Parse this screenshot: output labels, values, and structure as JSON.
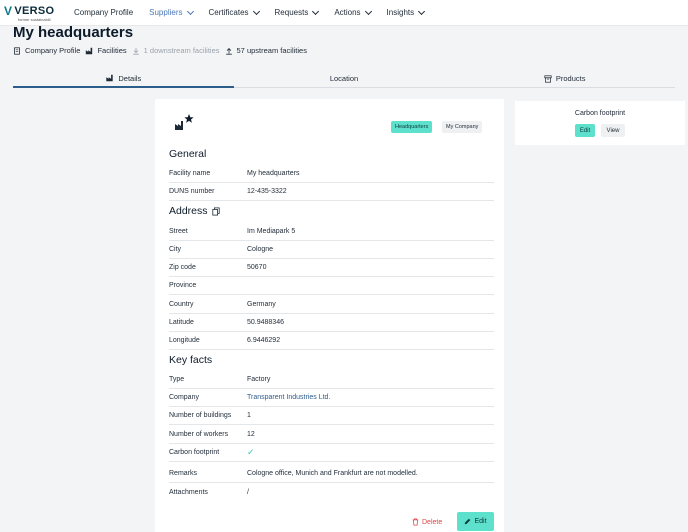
{
  "logo": {
    "name": "VERSO",
    "sub": "former sustainabill"
  },
  "nav": [
    {
      "label": "Company Profile",
      "dropdown": false,
      "active": false
    },
    {
      "label": "Suppliers",
      "dropdown": true,
      "active": true
    },
    {
      "label": "Certificates",
      "dropdown": true,
      "active": false
    },
    {
      "label": "Requests",
      "dropdown": true,
      "active": false
    },
    {
      "label": "Actions",
      "dropdown": true,
      "active": false
    },
    {
      "label": "Insights",
      "dropdown": true,
      "active": false
    }
  ],
  "page": {
    "title": "My headquarters"
  },
  "breadcrumb": {
    "profile": "Company Profile",
    "facilities": "Facilities",
    "downstream": "1 downstream facilities",
    "upstream": "57 upstream facilities"
  },
  "tabs": {
    "details": "Details",
    "location": "Location",
    "products": "Products"
  },
  "badges": {
    "hq": "Headquarters",
    "my_company": "My Company"
  },
  "general": {
    "heading": "General",
    "rows": [
      {
        "label": "Facility name",
        "value": "My headquarters"
      },
      {
        "label": "DUNS number",
        "value": "12-435-3322"
      }
    ]
  },
  "address": {
    "heading": "Address",
    "rows": [
      {
        "label": "Street",
        "value": "Im Mediapark 5"
      },
      {
        "label": "City",
        "value": "Cologne"
      },
      {
        "label": "Zip code",
        "value": "50670"
      },
      {
        "label": "Province",
        "value": ""
      },
      {
        "label": "Country",
        "value": "Germany"
      },
      {
        "label": "Latitude",
        "value": "50.9488346"
      },
      {
        "label": "Longitude",
        "value": "6.9446292"
      }
    ]
  },
  "keyfacts": {
    "heading": "Key facts",
    "rows": [
      {
        "label": "Type",
        "value": "Factory"
      },
      {
        "label": "Company",
        "value": "Transparent Industries Ltd."
      },
      {
        "label": "Number of buildings",
        "value": "1"
      },
      {
        "label": "Number of workers",
        "value": "12"
      },
      {
        "label": "Carbon footprint",
        "value": "✓"
      },
      {
        "label": "Remarks",
        "value": "Cologne office, Munich and Frankfurt are not modelled."
      },
      {
        "label": "Attachments",
        "value": "/"
      }
    ]
  },
  "actions": {
    "delete": "Delete",
    "edit": "Edit"
  },
  "carbon_card": {
    "title": "Carbon footprint",
    "edit": "Edit",
    "view": "View"
  },
  "colors": {
    "accent": "#5de0cc",
    "nav_active": "#4a78b8",
    "danger": "#d84545",
    "tab_underline": "#2d5d8a"
  }
}
